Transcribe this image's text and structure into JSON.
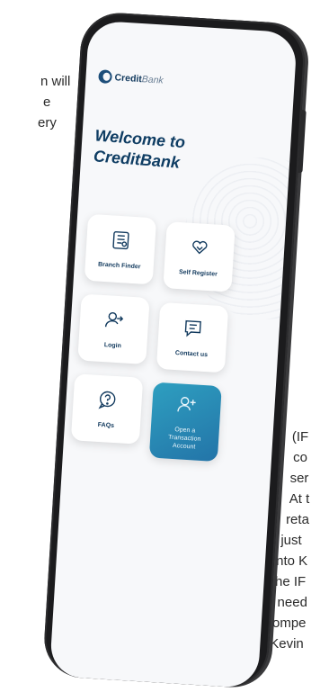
{
  "background_text": {
    "left_lines": [
      "n will",
      "e",
      "ery"
    ],
    "right_lines": [
      "(IF",
      "co",
      "ser",
      "At t",
      "reta",
      "just",
      "into K",
      "the IF",
      "a need",
      "compe",
      "Kevin"
    ]
  },
  "app": {
    "logo_primary": "Credit",
    "logo_secondary": "Bank",
    "welcome_line1": "Welcome to",
    "welcome_line2": "CreditBank",
    "tiles": [
      {
        "label": "Branch Finder",
        "icon": "map-grid-icon"
      },
      {
        "label": "Self Register",
        "icon": "hand-heart-icon"
      },
      {
        "label": "Login",
        "icon": "user-arrow-icon"
      },
      {
        "label": "Contact us",
        "icon": "chat-lines-icon"
      },
      {
        "label": "FAQs",
        "icon": "question-bubble-icon"
      },
      {
        "label": "Open a Transaction Account",
        "icon": "user-plus-icon"
      }
    ]
  },
  "colors": {
    "brand_navy": "#123a5e",
    "primary_tile": "#2a8ab8",
    "screen_bg": "#f7f8fa"
  }
}
